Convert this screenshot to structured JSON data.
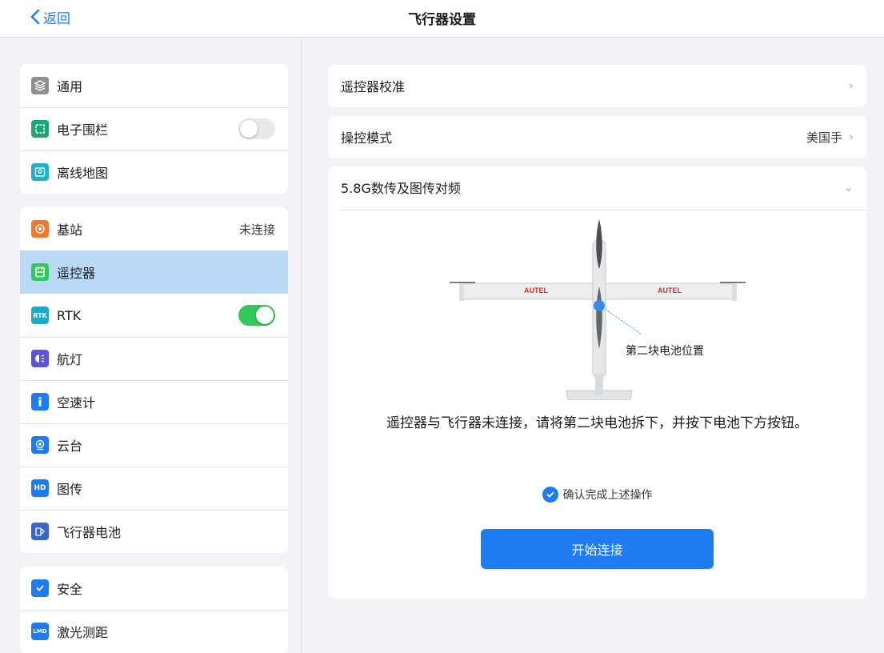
{
  "header": {
    "back_label": "返回",
    "title": "飞行器设置"
  },
  "sidebar": {
    "group1": [
      {
        "label": "通用",
        "icon": "general-icon"
      },
      {
        "label": "电子围栏",
        "icon": "geofence-icon",
        "toggle": false
      },
      {
        "label": "离线地图",
        "icon": "offline-map-icon"
      }
    ],
    "group2": [
      {
        "label": "基站",
        "icon": "base-station-icon",
        "value": "未连接"
      },
      {
        "label": "遥控器",
        "icon": "remote-controller-icon",
        "selected": true
      },
      {
        "label": "RTK",
        "icon": "rtk-icon",
        "toggle": true
      },
      {
        "label": "航灯",
        "icon": "nav-light-icon"
      },
      {
        "label": "空速计",
        "icon": "airspeed-icon"
      },
      {
        "label": "云台",
        "icon": "gimbal-icon"
      },
      {
        "label": "图传",
        "icon": "hd-transmission-icon"
      },
      {
        "label": "飞行器电池",
        "icon": "aircraft-battery-icon"
      }
    ],
    "group3": [
      {
        "label": "安全",
        "icon": "safety-icon"
      },
      {
        "label": "激光测距",
        "icon": "laser-range-icon"
      }
    ],
    "icon_texts": {
      "rtk": "RTK",
      "hd": "HD",
      "lmd": "LMD"
    }
  },
  "main": {
    "rc_calibration": "遥控器校准",
    "control_mode": {
      "label": "操控模式",
      "value": "美国手"
    },
    "pairing": {
      "label": "5.8G数传及图传对频",
      "battery_label": "第二块电池位置",
      "brand_text": "AUTEL",
      "instruction": "遥控器与飞行器未连接，请将第二块电池拆下，并按下电池下方按钮。",
      "confirm_label": "确认完成上述操作",
      "confirm_checked": true,
      "connect_button": "开始连接"
    }
  },
  "colors": {
    "accent": "#1f7cf0",
    "selected_row": "#b9daf7",
    "toggle_on": "#34c759",
    "brand_red": "#d0312d"
  }
}
